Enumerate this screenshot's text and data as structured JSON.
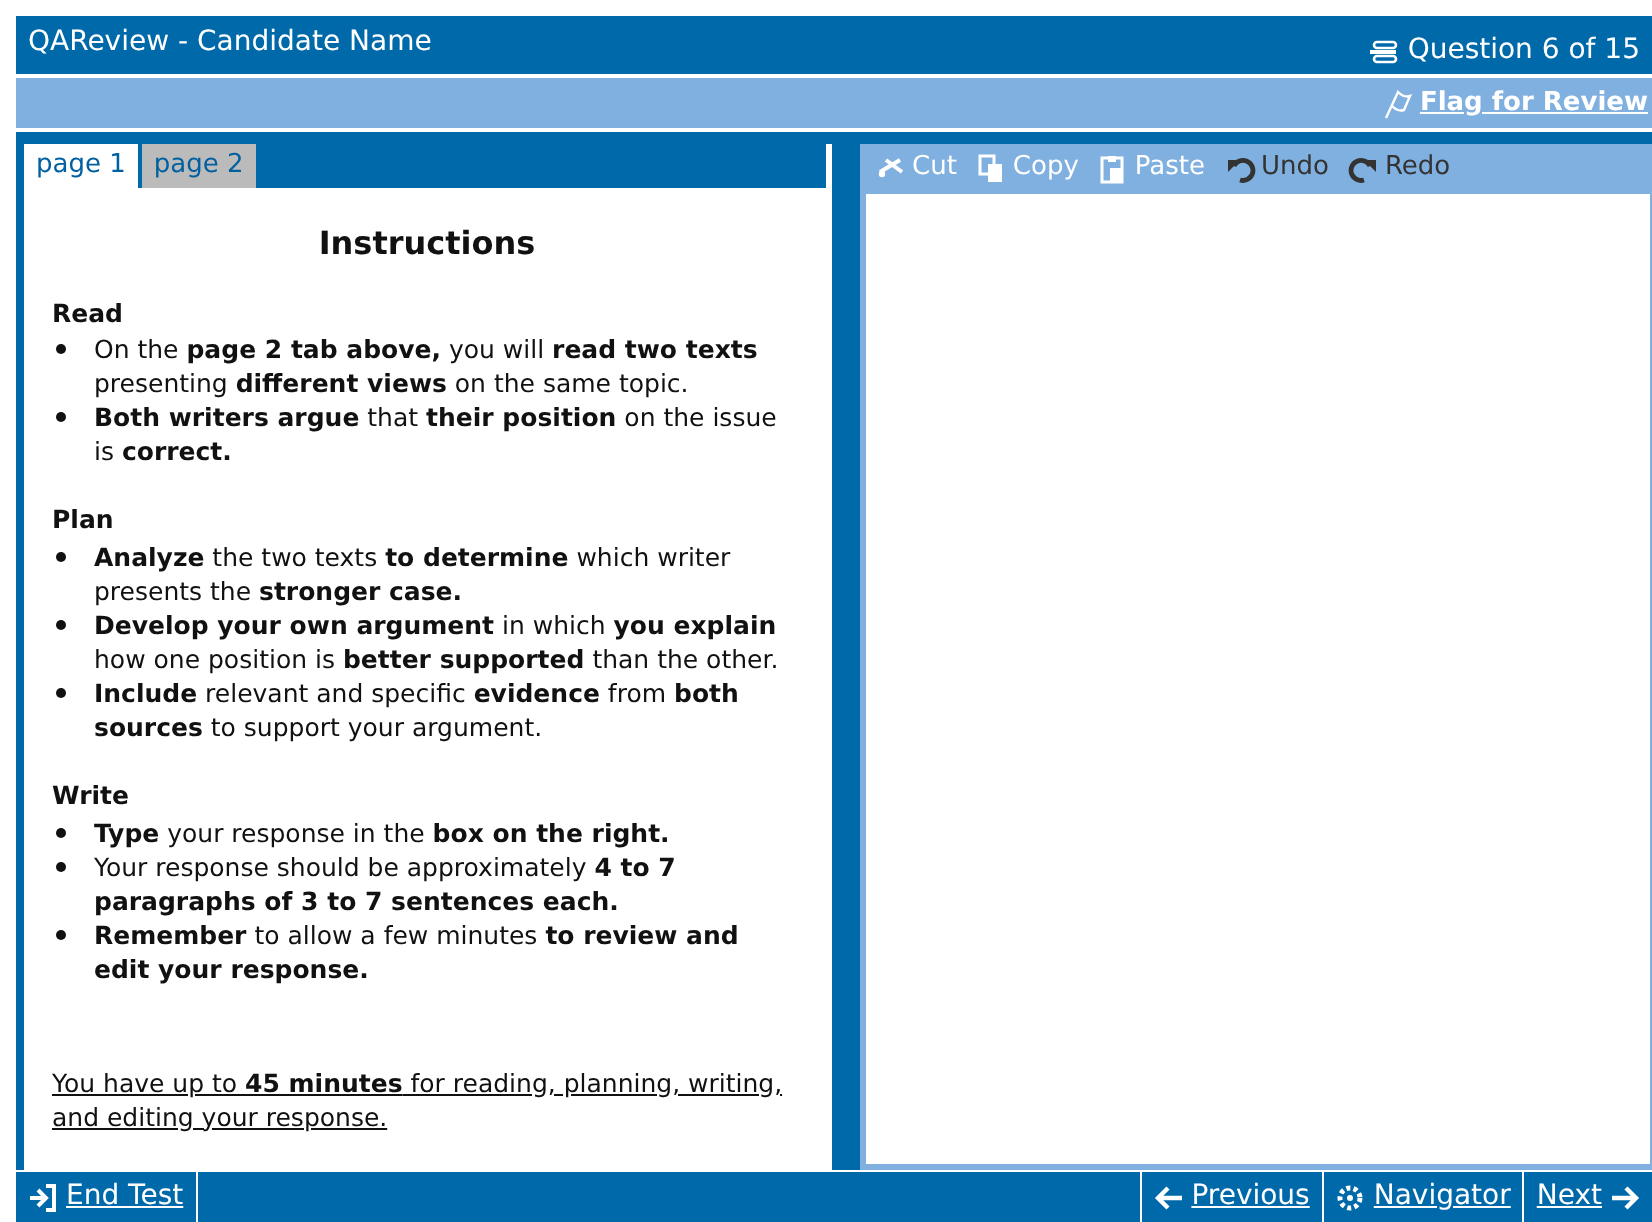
{
  "window": {
    "title": "QAReview - Candidate Name",
    "question_counter": "Question 6 of 15"
  },
  "flag": {
    "label": "Flag for Review"
  },
  "tabs": [
    {
      "label": "page 1",
      "selected": true
    },
    {
      "label": "page 2",
      "selected": false
    }
  ],
  "instructions": {
    "title": "Instructions",
    "sections": [
      {
        "heading": "Read",
        "bullets": [
          "On the **page 2 tab above,** you will **read two texts** presenting **different views** on the same topic.",
          "**Both writers argue** that **their position** on the issue is **correct.**"
        ]
      },
      {
        "heading": "Plan",
        "bullets": [
          "**Analyze** the two texts **to determine** which writer presents the **stronger case.**",
          "**Develop your own argument** in which **you explain** how one position is **better supported** than the other.",
          "**Include** relevant and specific **evidence** from **both sources** to support your argument."
        ]
      },
      {
        "heading": "Write",
        "bullets": [
          "**Type** your response in the **box on the right.**",
          "Your response should be approximately **4 to 7 paragraphs of 3 to 7 sentences each.**",
          "**Remember** to allow a few minutes **to review and edit your response.**"
        ]
      }
    ],
    "note": "You have up to **45 minutes** for reading, planning, writing, and editing your response."
  },
  "toolbar": [
    {
      "kind": "cut",
      "label": "Cut"
    },
    {
      "kind": "copy",
      "label": "Copy"
    },
    {
      "kind": "paste",
      "label": "Paste"
    },
    {
      "kind": "undo",
      "label": "Undo"
    },
    {
      "kind": "redo",
      "label": "Redo"
    }
  ],
  "footer": {
    "end_test": "End Test",
    "previous": "Previous",
    "navigator": "Navigator",
    "next": "Next"
  }
}
